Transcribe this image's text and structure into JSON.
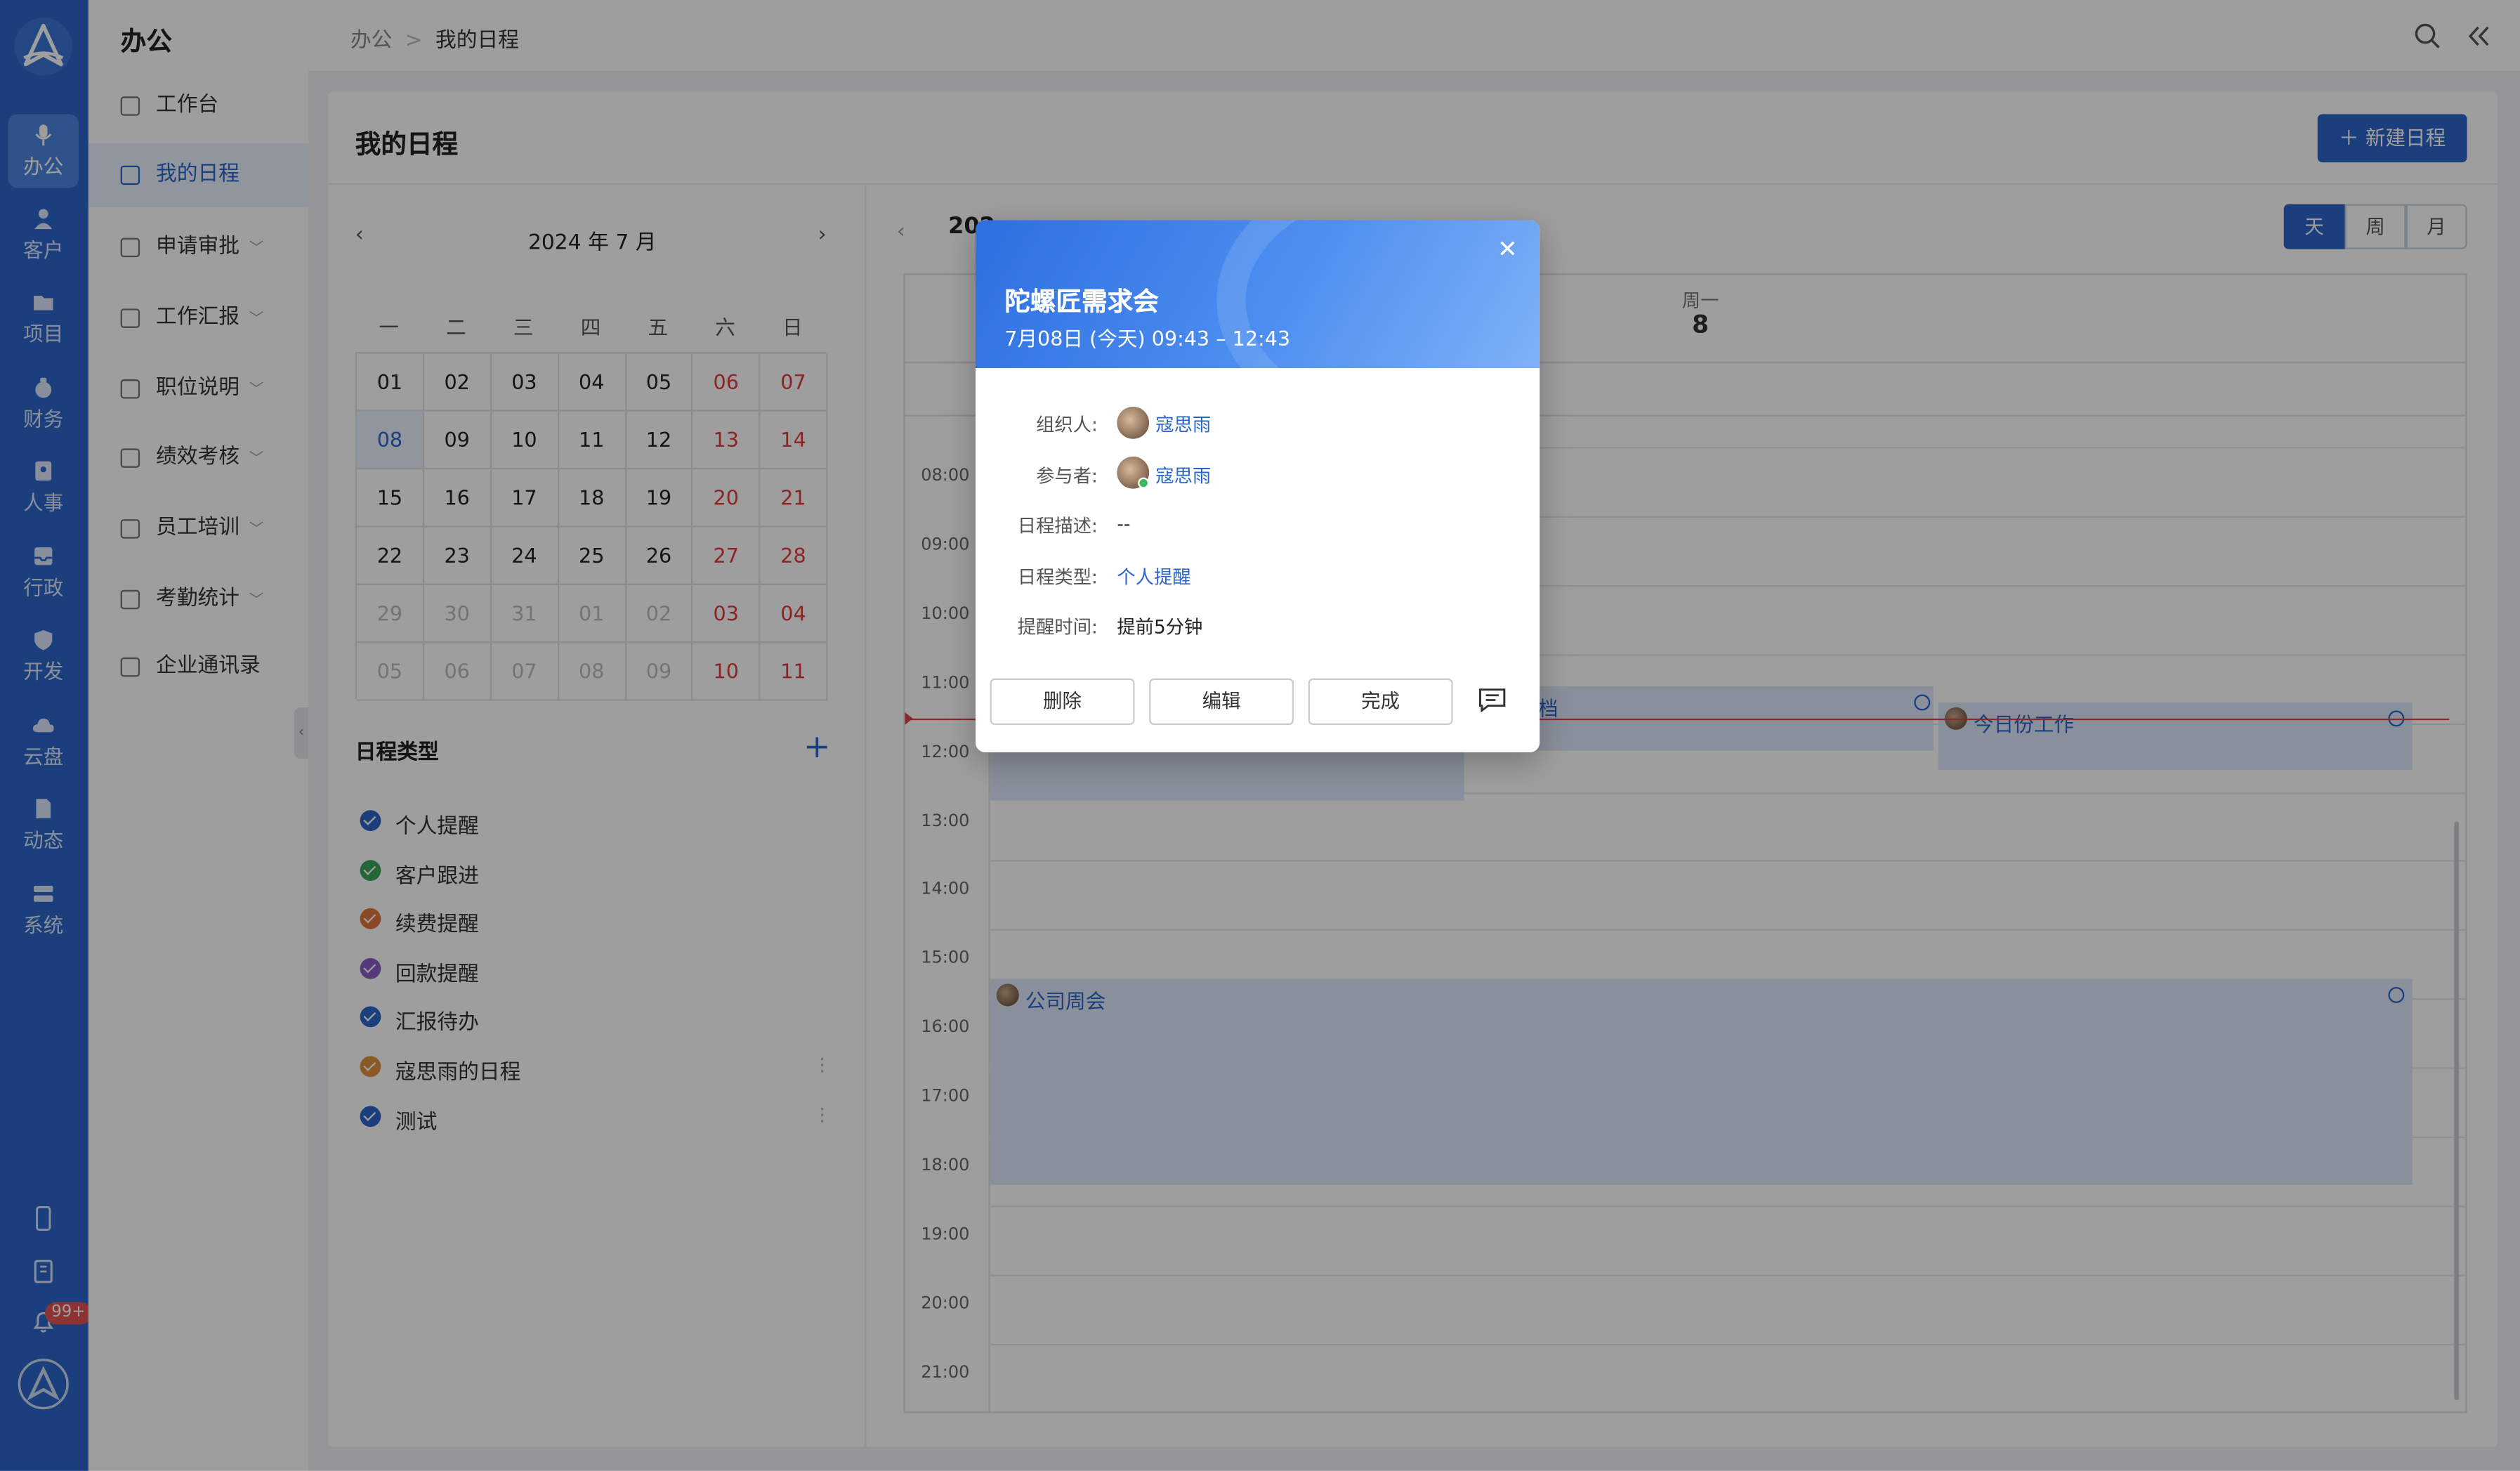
{
  "rail": {
    "items": [
      {
        "label": "办公",
        "icon": "mic-icon"
      },
      {
        "label": "客户",
        "icon": "user-icon"
      },
      {
        "label": "项目",
        "icon": "folder-icon"
      },
      {
        "label": "财务",
        "icon": "money-bag-icon"
      },
      {
        "label": "人事",
        "icon": "id-card-icon"
      },
      {
        "label": "行政",
        "icon": "tray-icon"
      },
      {
        "label": "开发",
        "icon": "shield-icon"
      },
      {
        "label": "云盘",
        "icon": "cloud-icon"
      },
      {
        "label": "动态",
        "icon": "document-icon"
      },
      {
        "label": "系统",
        "icon": "settings-icon"
      }
    ],
    "badge": "99+"
  },
  "nav2": {
    "title": "办公",
    "items": [
      {
        "label": "工作台"
      },
      {
        "label": "我的日程"
      },
      {
        "label": "申请审批"
      },
      {
        "label": "工作汇报"
      },
      {
        "label": "职位说明"
      },
      {
        "label": "绩效考核"
      },
      {
        "label": "员工培训"
      },
      {
        "label": "考勤统计"
      },
      {
        "label": "企业通讯录"
      }
    ]
  },
  "breadcrumb": {
    "root": "办公",
    "current": "我的日程"
  },
  "page": {
    "title": "我的日程",
    "new_button": "新建日程"
  },
  "mini_calendar": {
    "month_label": "2024 年 7 月",
    "weekdays": [
      "一",
      "二",
      "三",
      "四",
      "五",
      "六",
      "日"
    ],
    "weeks": [
      [
        "01",
        "02",
        "03",
        "04",
        "05",
        "06",
        "07"
      ],
      [
        "08",
        "09",
        "10",
        "11",
        "12",
        "13",
        "14"
      ],
      [
        "15",
        "16",
        "17",
        "18",
        "19",
        "20",
        "21"
      ],
      [
        "22",
        "23",
        "24",
        "25",
        "26",
        "27",
        "28"
      ],
      [
        "29",
        "30",
        "31",
        "01",
        "02",
        "03",
        "04"
      ],
      [
        "05",
        "06",
        "07",
        "08",
        "09",
        "10",
        "11"
      ]
    ]
  },
  "schedule_types": {
    "title": "日程类型",
    "items": [
      {
        "label": "个人提醒",
        "color": "#2a66c9"
      },
      {
        "label": "客户跟进",
        "color": "#3aa55a"
      },
      {
        "label": "续费提醒",
        "color": "#e0753a"
      },
      {
        "label": "回款提醒",
        "color": "#8b5cc9"
      },
      {
        "label": "汇报待办",
        "color": "#2a66c9"
      },
      {
        "label": "寇思雨的日程",
        "color": "#e0913a"
      },
      {
        "label": "测试",
        "color": "#2a66c9"
      }
    ]
  },
  "day_view": {
    "title": "202",
    "view_tabs": [
      "天",
      "周",
      "月"
    ],
    "active_tab": "天",
    "weekday": "周一",
    "day_number": "8",
    "hours": [
      "08:00",
      "09:00",
      "10:00",
      "11:00",
      "12:00",
      "13:00",
      "14:00",
      "15:00",
      "16:00",
      "17:00",
      "18:00",
      "19:00",
      "20:00",
      "21:00"
    ],
    "events": [
      {
        "title": "档"
      },
      {
        "title": "今日份工作"
      },
      {
        "title": "公司周会"
      }
    ]
  },
  "popover": {
    "title": "陀螺匠需求会",
    "time": "7月08日 (今天) 09:43 – 12:43",
    "fields": {
      "organizer_label": "组织人:",
      "organizer": "寇思雨",
      "participant_label": "参与者:",
      "participant": "寇思雨",
      "desc_label": "日程描述:",
      "desc": "--",
      "type_label": "日程类型:",
      "type": "个人提醒",
      "remind_label": "提醒时间:",
      "remind": "提前5分钟"
    },
    "buttons": {
      "delete": "删除",
      "edit": "编辑",
      "done": "完成"
    }
  }
}
